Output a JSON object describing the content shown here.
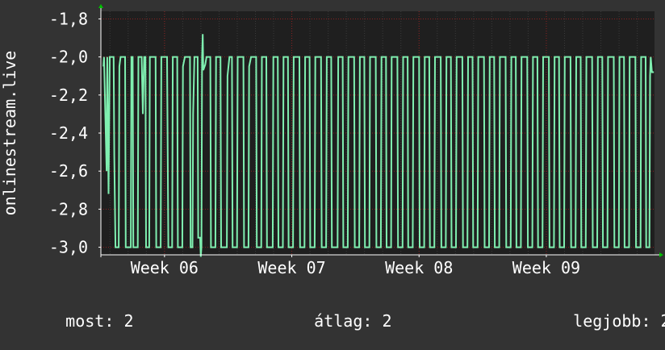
{
  "chart_data": {
    "type": "line",
    "ylabel": "onlinestream.live",
    "xlabel": "",
    "title": "",
    "ylim": [
      -3.04,
      -1.76
    ],
    "xlim": [
      5.5,
      9.85
    ],
    "yticks": [
      {
        "value": -1.8,
        "label": "-1,8"
      },
      {
        "value": -2.0,
        "label": "-2,0"
      },
      {
        "value": -2.2,
        "label": "-2,2"
      },
      {
        "value": -2.4,
        "label": "-2,4"
      },
      {
        "value": -2.6,
        "label": "-2,6"
      },
      {
        "value": -2.8,
        "label": "-2,8"
      },
      {
        "value": -3.0,
        "label": "-3,0"
      }
    ],
    "xticks": [
      {
        "value": 6,
        "label": "Week 06"
      },
      {
        "value": 7,
        "label": "Week 07"
      },
      {
        "value": 8,
        "label": "Week 08"
      },
      {
        "value": 9,
        "label": "Week 09"
      }
    ],
    "grid": true,
    "colors": {
      "background": "#333333",
      "plot_background": "#1f1f1f",
      "line": "#7fefb0",
      "grid": "#8a2020",
      "axis": "#ffffff",
      "arrow": "#00c000"
    },
    "series": [
      {
        "points": [
          [
            5.52,
            -2.05
          ],
          [
            5.525,
            -2.0
          ],
          [
            5.535,
            -2.3
          ],
          [
            5.545,
            -2.6
          ],
          [
            5.55,
            -2.0
          ],
          [
            5.56,
            -2.72
          ],
          [
            5.57,
            -2.0
          ],
          [
            5.6,
            -2.0
          ],
          [
            5.605,
            -2.52
          ],
          [
            5.615,
            -3.0
          ],
          [
            5.64,
            -3.0
          ],
          [
            5.645,
            -2.05
          ],
          [
            5.655,
            -2.0
          ],
          [
            5.69,
            -2.0
          ],
          [
            5.695,
            -3.0
          ],
          [
            5.735,
            -3.0
          ],
          [
            5.74,
            -2.0
          ],
          [
            5.75,
            -2.0
          ],
          [
            5.755,
            -3.0
          ],
          [
            5.79,
            -3.0
          ],
          [
            5.795,
            -2.0
          ],
          [
            5.82,
            -2.0
          ],
          [
            5.83,
            -2.3
          ],
          [
            5.84,
            -2.0
          ],
          [
            5.85,
            -2.0
          ],
          [
            5.855,
            -3.0
          ],
          [
            5.88,
            -3.0
          ],
          [
            5.885,
            -2.0
          ],
          [
            5.93,
            -2.0
          ],
          [
            5.935,
            -3.0
          ],
          [
            5.97,
            -3.0
          ],
          [
            5.975,
            -2.0
          ],
          [
            6.02,
            -2.0
          ],
          [
            6.03,
            -3.0
          ],
          [
            6.06,
            -3.0
          ],
          [
            6.065,
            -2.0
          ],
          [
            6.1,
            -2.0
          ],
          [
            6.105,
            -3.0
          ],
          [
            6.14,
            -3.0
          ],
          [
            6.145,
            -2.05
          ],
          [
            6.16,
            -2.0
          ],
          [
            6.2,
            -2.0
          ],
          [
            6.205,
            -3.0
          ],
          [
            6.22,
            -3.0
          ],
          [
            6.225,
            -2.3
          ],
          [
            6.235,
            -2.0
          ],
          [
            6.26,
            -2.0
          ],
          [
            6.265,
            -2.95
          ],
          [
            6.28,
            -2.95
          ],
          [
            6.285,
            -3.05
          ],
          [
            6.29,
            -3.0
          ],
          [
            6.295,
            -2.0
          ],
          [
            6.3,
            -1.88
          ],
          [
            6.305,
            -2.07
          ],
          [
            6.32,
            -2.04
          ],
          [
            6.33,
            -2.0
          ],
          [
            6.36,
            -2.0
          ],
          [
            6.365,
            -3.0
          ],
          [
            6.4,
            -3.0
          ],
          [
            6.405,
            -2.0
          ],
          [
            6.44,
            -2.0
          ],
          [
            6.445,
            -3.0
          ],
          [
            6.49,
            -3.0
          ],
          [
            6.495,
            -2.1
          ],
          [
            6.51,
            -2.0
          ],
          [
            6.53,
            -2.0
          ],
          [
            6.535,
            -3.0
          ],
          [
            6.57,
            -3.0
          ],
          [
            6.575,
            -2.0
          ],
          [
            6.62,
            -2.0
          ],
          [
            6.625,
            -3.0
          ],
          [
            6.66,
            -3.0
          ],
          [
            6.665,
            -2.05
          ],
          [
            6.68,
            -2.0
          ],
          [
            6.72,
            -2.0
          ],
          [
            6.725,
            -3.0
          ],
          [
            6.76,
            -3.0
          ],
          [
            6.765,
            -2.0
          ],
          [
            6.8,
            -2.0
          ],
          [
            6.805,
            -3.0
          ],
          [
            6.85,
            -3.0
          ],
          [
            6.855,
            -2.0
          ],
          [
            6.89,
            -2.0
          ],
          [
            6.895,
            -3.0
          ],
          [
            6.93,
            -3.0
          ],
          [
            6.935,
            -2.0
          ],
          [
            6.97,
            -2.0
          ],
          [
            6.975,
            -3.0
          ],
          [
            7.01,
            -3.0
          ],
          [
            7.015,
            -2.0
          ],
          [
            7.06,
            -2.0
          ],
          [
            7.065,
            -3.0
          ],
          [
            7.1,
            -3.0
          ],
          [
            7.105,
            -2.0
          ],
          [
            7.14,
            -2.0
          ],
          [
            7.145,
            -3.0
          ],
          [
            7.18,
            -3.0
          ],
          [
            7.185,
            -2.0
          ],
          [
            7.23,
            -2.0
          ],
          [
            7.235,
            -3.0
          ],
          [
            7.27,
            -3.0
          ],
          [
            7.275,
            -2.0
          ],
          [
            7.31,
            -2.0
          ],
          [
            7.315,
            -3.0
          ],
          [
            7.36,
            -3.0
          ],
          [
            7.365,
            -2.0
          ],
          [
            7.4,
            -2.0
          ],
          [
            7.405,
            -3.0
          ],
          [
            7.44,
            -3.0
          ],
          [
            7.445,
            -2.0
          ],
          [
            7.49,
            -2.0
          ],
          [
            7.495,
            -3.0
          ],
          [
            7.53,
            -3.0
          ],
          [
            7.535,
            -2.0
          ],
          [
            7.57,
            -2.0
          ],
          [
            7.575,
            -3.0
          ],
          [
            7.61,
            -3.0
          ],
          [
            7.615,
            -2.0
          ],
          [
            7.66,
            -2.0
          ],
          [
            7.665,
            -3.0
          ],
          [
            7.7,
            -3.0
          ],
          [
            7.705,
            -2.0
          ],
          [
            7.74,
            -2.0
          ],
          [
            7.745,
            -3.0
          ],
          [
            7.78,
            -3.0
          ],
          [
            7.785,
            -2.0
          ],
          [
            7.83,
            -2.0
          ],
          [
            7.835,
            -3.0
          ],
          [
            7.87,
            -3.0
          ],
          [
            7.875,
            -2.0
          ],
          [
            7.91,
            -2.0
          ],
          [
            7.915,
            -3.0
          ],
          [
            7.95,
            -3.0
          ],
          [
            7.955,
            -2.0
          ],
          [
            8.0,
            -2.0
          ],
          [
            8.005,
            -3.0
          ],
          [
            8.04,
            -3.0
          ],
          [
            8.045,
            -2.0
          ],
          [
            8.08,
            -2.0
          ],
          [
            8.085,
            -3.0
          ],
          [
            8.12,
            -3.0
          ],
          [
            8.125,
            -2.0
          ],
          [
            8.17,
            -2.0
          ],
          [
            8.175,
            -3.0
          ],
          [
            8.21,
            -3.0
          ],
          [
            8.215,
            -2.0
          ],
          [
            8.25,
            -2.0
          ],
          [
            8.255,
            -3.0
          ],
          [
            8.29,
            -3.0
          ],
          [
            8.295,
            -2.0
          ],
          [
            8.34,
            -2.0
          ],
          [
            8.345,
            -3.0
          ],
          [
            8.38,
            -3.0
          ],
          [
            8.385,
            -2.0
          ],
          [
            8.42,
            -2.0
          ],
          [
            8.425,
            -3.0
          ],
          [
            8.46,
            -3.0
          ],
          [
            8.465,
            -2.0
          ],
          [
            8.51,
            -2.0
          ],
          [
            8.515,
            -3.0
          ],
          [
            8.55,
            -3.0
          ],
          [
            8.555,
            -2.0
          ],
          [
            8.59,
            -2.0
          ],
          [
            8.595,
            -3.0
          ],
          [
            8.63,
            -3.0
          ],
          [
            8.635,
            -2.0
          ],
          [
            8.68,
            -2.0
          ],
          [
            8.685,
            -3.0
          ],
          [
            8.72,
            -3.0
          ],
          [
            8.725,
            -2.0
          ],
          [
            8.76,
            -2.0
          ],
          [
            8.765,
            -3.0
          ],
          [
            8.8,
            -3.0
          ],
          [
            8.805,
            -2.0
          ],
          [
            8.85,
            -2.0
          ],
          [
            8.855,
            -3.0
          ],
          [
            8.89,
            -3.0
          ],
          [
            8.895,
            -2.0
          ],
          [
            8.93,
            -2.0
          ],
          [
            8.935,
            -3.0
          ],
          [
            8.97,
            -3.0
          ],
          [
            8.975,
            -2.0
          ],
          [
            9.02,
            -2.0
          ],
          [
            9.025,
            -3.0
          ],
          [
            9.06,
            -3.0
          ],
          [
            9.065,
            -2.0
          ],
          [
            9.1,
            -2.0
          ],
          [
            9.105,
            -3.0
          ],
          [
            9.14,
            -3.0
          ],
          [
            9.145,
            -2.0
          ],
          [
            9.19,
            -2.0
          ],
          [
            9.195,
            -3.0
          ],
          [
            9.23,
            -3.0
          ],
          [
            9.235,
            -2.0
          ],
          [
            9.27,
            -2.0
          ],
          [
            9.275,
            -3.0
          ],
          [
            9.31,
            -3.0
          ],
          [
            9.315,
            -2.0
          ],
          [
            9.36,
            -2.0
          ],
          [
            9.365,
            -3.0
          ],
          [
            9.4,
            -3.0
          ],
          [
            9.405,
            -2.0
          ],
          [
            9.44,
            -2.0
          ],
          [
            9.445,
            -3.0
          ],
          [
            9.48,
            -3.0
          ],
          [
            9.485,
            -2.0
          ],
          [
            9.53,
            -2.0
          ],
          [
            9.535,
            -3.0
          ],
          [
            9.57,
            -3.0
          ],
          [
            9.575,
            -2.0
          ],
          [
            9.61,
            -2.0
          ],
          [
            9.615,
            -3.0
          ],
          [
            9.65,
            -3.0
          ],
          [
            9.655,
            -2.0
          ],
          [
            9.7,
            -2.0
          ],
          [
            9.705,
            -3.0
          ],
          [
            9.74,
            -3.0
          ],
          [
            9.745,
            -2.0
          ],
          [
            9.78,
            -2.0
          ],
          [
            9.785,
            -3.0
          ],
          [
            9.81,
            -3.0
          ],
          [
            9.815,
            -2.1
          ],
          [
            9.82,
            -2.0
          ],
          [
            9.83,
            -2.08
          ],
          [
            9.845,
            -2.08
          ]
        ]
      }
    ],
    "stats": {
      "current_label": "most:",
      "current_value": "2",
      "average_label": "átlag:",
      "average_value": "2",
      "max_label": "legjobb:",
      "max_value": "2"
    }
  }
}
